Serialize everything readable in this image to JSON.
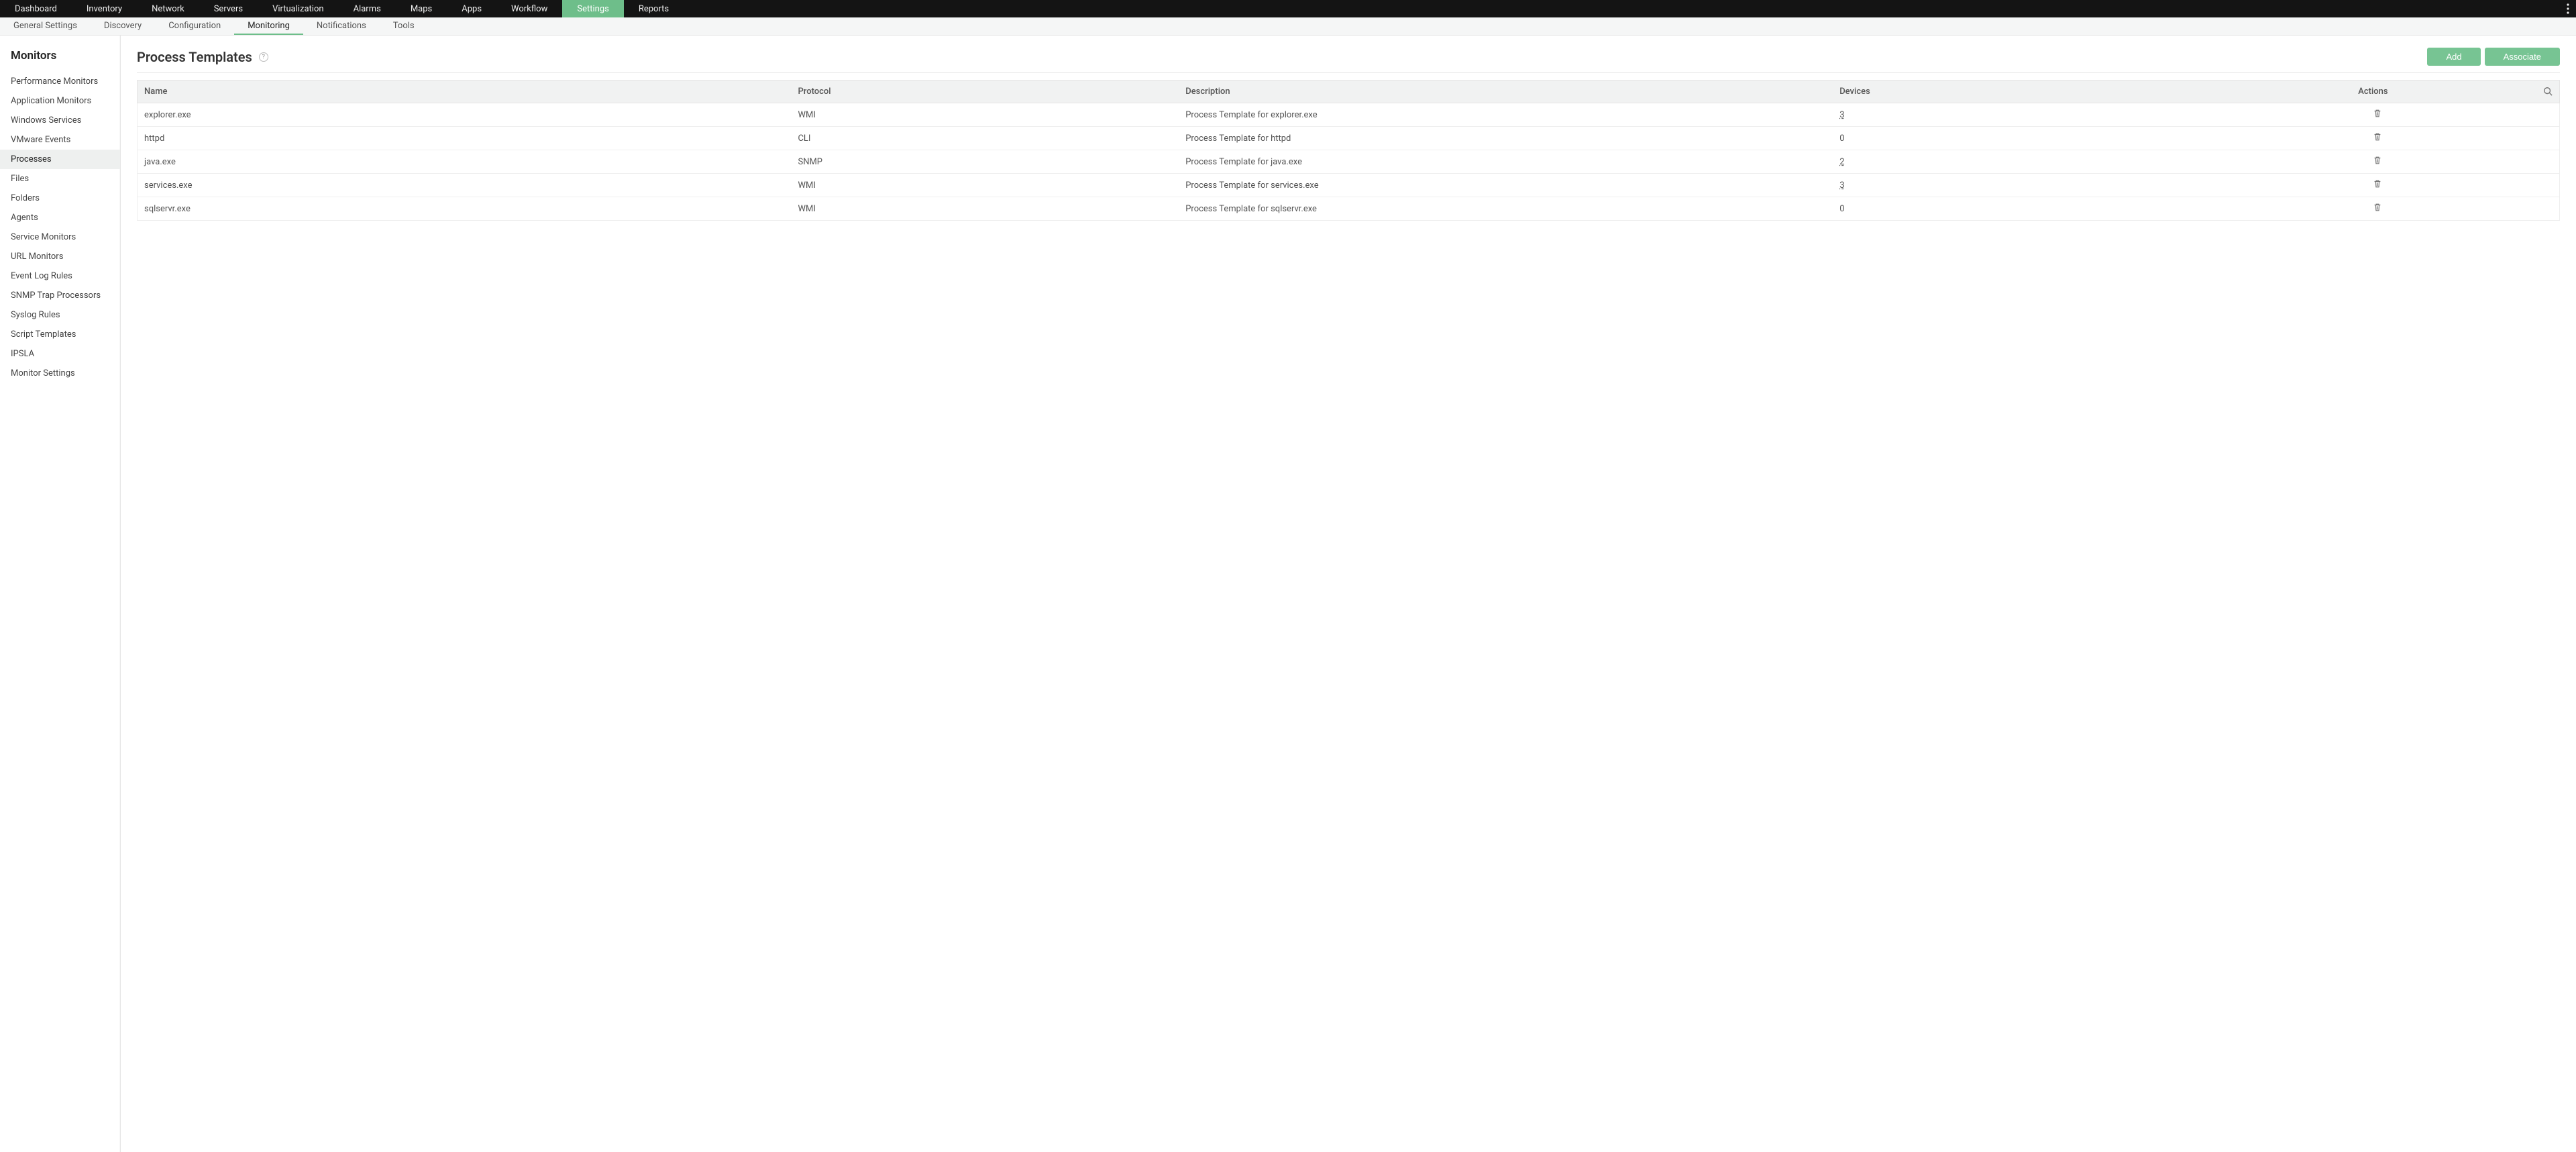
{
  "topnav": {
    "items": [
      "Dashboard",
      "Inventory",
      "Network",
      "Servers",
      "Virtualization",
      "Alarms",
      "Maps",
      "Apps",
      "Workflow",
      "Settings",
      "Reports"
    ],
    "active": "Settings"
  },
  "subnav": {
    "items": [
      "General Settings",
      "Discovery",
      "Configuration",
      "Monitoring",
      "Notifications",
      "Tools"
    ],
    "active": "Monitoring"
  },
  "sidebar": {
    "heading": "Monitors",
    "items": [
      "Performance Monitors",
      "Application Monitors",
      "Windows Services",
      "VMware Events",
      "Processes",
      "Files",
      "Folders",
      "Agents",
      "Service Monitors",
      "URL Monitors",
      "Event Log Rules",
      "SNMP Trap Processors",
      "Syslog Rules",
      "Script Templates",
      "IPSLA",
      "Monitor Settings"
    ],
    "active": "Processes"
  },
  "page": {
    "title": "Process Templates",
    "help_glyph": "?",
    "add_label": "Add",
    "associate_label": "Associate"
  },
  "table": {
    "headers": {
      "name": "Name",
      "protocol": "Protocol",
      "description": "Description",
      "devices": "Devices",
      "actions": "Actions"
    },
    "rows": [
      {
        "name": "explorer.exe",
        "protocol": "WMI",
        "description": "Process Template for explorer.exe",
        "devices": "3",
        "devices_link": true
      },
      {
        "name": "httpd",
        "protocol": "CLI",
        "description": "Process Template for httpd",
        "devices": "0",
        "devices_link": false
      },
      {
        "name": "java.exe",
        "protocol": "SNMP",
        "description": "Process Template for java.exe",
        "devices": "2",
        "devices_link": true
      },
      {
        "name": "services.exe",
        "protocol": "WMI",
        "description": "Process Template for services.exe",
        "devices": "3",
        "devices_link": true
      },
      {
        "name": "sqlservr.exe",
        "protocol": "WMI",
        "description": "Process Template for sqlservr.exe",
        "devices": "0",
        "devices_link": false
      }
    ]
  }
}
